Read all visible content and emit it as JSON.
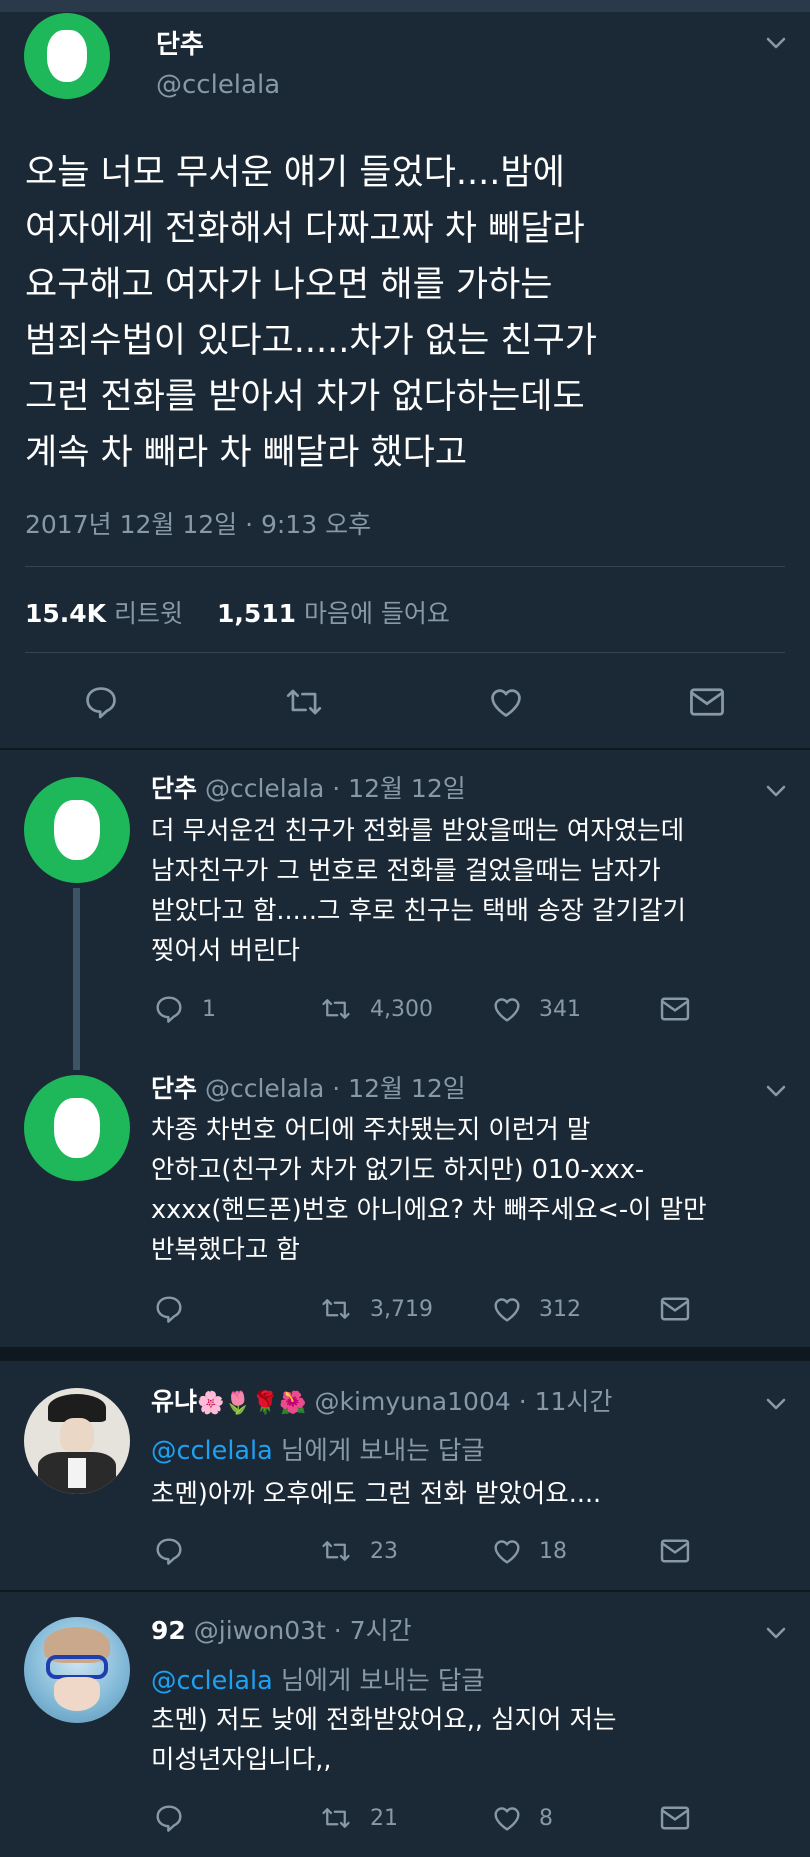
{
  "main_tweet": {
    "display_name": "단추",
    "handle": "@cclelala",
    "text_lines": [
      "오늘 너모 무서운 얘기 들었다....밤에",
      "여자에게 전화해서 다짜고짜 차 빼달라",
      "요구해고 여자가 나오면 해를 가하는",
      "범죄수법이 있다고.....차가 없는 친구가",
      "그런 전화를 받아서 차가 없다하는데도",
      "계속 차 빼라 차 빼달라 했다고"
    ],
    "timestamp": "2017년 12월 12일 · 9:13 오후",
    "retweet_count": "15.4K",
    "retweet_label": "리트윗",
    "like_count": "1,511",
    "like_label": "마음에 들어요"
  },
  "replies": [
    {
      "display_name": "단추",
      "handle": "@cclelala",
      "time": "· 12월 12일",
      "lines": [
        "더 무서운건 친구가 전화를 받았을때는 여자였는데",
        "남자친구가 그 번호로 전화를 걸었을때는 남자가",
        "받았다고 함.....그 후로 친구는 택배 송장 갈기갈기",
        "찢어서 버린다"
      ],
      "reply_count": "1",
      "retweet_count": "4,300",
      "like_count": "341"
    },
    {
      "display_name": "단추",
      "handle": "@cclelala",
      "time": "· 12월 12일",
      "lines": [
        "차종 차번호 어디에 주차됐는지 이런거 말",
        "안하고(친구가 차가 없기도 하지만) 010-xxx-",
        "xxxx(핸드폰)번호 아니에요? 차 빼주세요<-이 말만",
        "반복했다고 함"
      ],
      "reply_count": "",
      "retweet_count": "3,719",
      "like_count": "312"
    },
    {
      "display_name": "유냐",
      "emojis": "🌸🌷🌹🌺",
      "handle": "@kimyuna1004",
      "time": "· 11시간",
      "reply_to_handle": "@cclelala",
      "reply_to_suffix": "님에게 보내는 답글",
      "lines": [
        "초멘)아까 오후에도 그런 전화 받았어요...."
      ],
      "reply_count": "",
      "retweet_count": "23",
      "like_count": "18"
    },
    {
      "display_name": "92",
      "handle": "@jiwon03t",
      "time": "· 7시간",
      "reply_to_handle": "@cclelala",
      "reply_to_suffix": "님에게 보내는 답글",
      "lines": [
        "초멘) 저도 낮에 전화받았어요,, 심지어 저는",
        "미성년자입니다,,"
      ],
      "reply_count": "",
      "retweet_count": "21",
      "like_count": "8"
    }
  ],
  "icons": {
    "reply": "reply-icon",
    "retweet": "retweet-icon",
    "like": "heart-icon",
    "dm": "envelope-icon",
    "menu": "chevron-down-icon"
  },
  "colors": {
    "background": "#1b2836",
    "muted": "#8899a6",
    "link": "#1da1f2",
    "avatar_green": "#1eb85a"
  }
}
